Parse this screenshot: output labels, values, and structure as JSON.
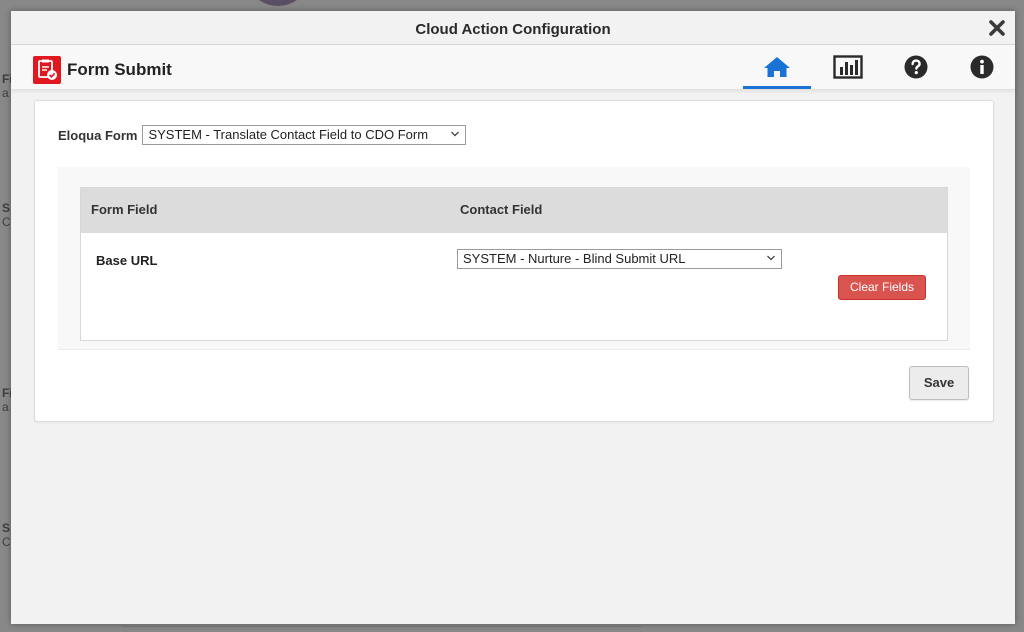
{
  "dialog": {
    "title": "Cloud Action Configuration",
    "close_icon": "close-icon"
  },
  "app": {
    "title": "Form Submit",
    "logo_icon": "form-submit-logo-icon",
    "nav": [
      {
        "icon": "home-icon",
        "active": true
      },
      {
        "icon": "chart-icon",
        "active": false
      },
      {
        "icon": "help-icon",
        "active": false
      },
      {
        "icon": "info-icon",
        "active": false
      }
    ]
  },
  "form": {
    "eloqua_form_label": "Eloqua Form",
    "eloqua_form_value": "SYSTEM - Translate Contact Field to CDO Form"
  },
  "mapping": {
    "headers": {
      "form_field": "Form Field",
      "contact_field": "Contact Field"
    },
    "rows": [
      {
        "form_field": "Base URL",
        "contact_field": "SYSTEM - Nurture - Blind Submit URL"
      }
    ],
    "clear_label": "Clear Fields"
  },
  "actions": {
    "save_label": "Save"
  },
  "colors": {
    "accent": "#1a73d4",
    "danger": "#d9534f",
    "logo": "#e0181f"
  }
}
